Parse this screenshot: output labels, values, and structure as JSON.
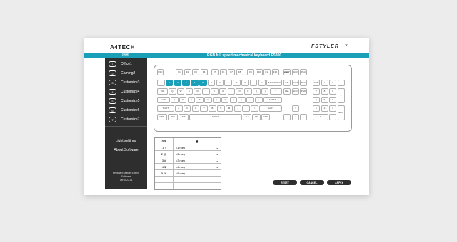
{
  "header": {
    "logo": "A4TECH",
    "logo_sub": "",
    "brand": "FSTYLER",
    "brand_sub": "",
    "close": "×",
    "keyboard_icon": "⌨",
    "title": "RGB full speed mechanical keyboard FS300"
  },
  "sidebar": {
    "profiles": [
      {
        "num": "1",
        "label": "Office1"
      },
      {
        "num": "2",
        "label": "Gaming2"
      },
      {
        "num": "3",
        "label": "Customize3"
      },
      {
        "num": "4",
        "label": "Customize4"
      },
      {
        "num": "5",
        "label": "Customize5"
      },
      {
        "num": "6",
        "label": "Customize6"
      },
      {
        "num": "7",
        "label": "Customize7"
      }
    ],
    "light_settings": "Light settings",
    "about": "About Software",
    "version_line1": "Keyboard Master Editing",
    "version_line2": "Software",
    "version_line3": "Ver.2022.11"
  },
  "keyboard": {
    "row0": [
      "ESC",
      "F1",
      "F2",
      "F3",
      "F4",
      "F5",
      "F6",
      "F7",
      "F8",
      "F9",
      "F10",
      "F11",
      "F12",
      "PRT",
      "SCR",
      "PAU"
    ],
    "row1": [
      "~",
      "1",
      "2",
      "3",
      "4",
      "5",
      "6",
      "7",
      "8",
      "9",
      "0",
      "-",
      "=",
      "BACKSPACE",
      "INS",
      "HOM",
      "PGU"
    ],
    "row2": [
      "TAB",
      "Q",
      "W",
      "E",
      "R",
      "T",
      "Y",
      "U",
      "I",
      "O",
      "P",
      "[",
      "]",
      "\\",
      "DEL",
      "END",
      "PGD"
    ],
    "row3": [
      "CAPS",
      "A",
      "S",
      "D",
      "F",
      "G",
      "H",
      "J",
      "K",
      "L",
      ";",
      "'",
      "ENTER"
    ],
    "row4": [
      "SHIFT",
      "Z",
      "X",
      "C",
      "V",
      "B",
      "N",
      "M",
      ",",
      ".",
      "/",
      "SHIFT",
      "↑"
    ],
    "row5": [
      "CTRL",
      "WIN",
      "ALT",
      "SPACE",
      "ALT",
      "FN",
      "CTRL",
      "←",
      "↓",
      "→"
    ],
    "numpad": {
      "r1": [
        "NUM",
        "/",
        "*",
        "-"
      ],
      "r2": [
        "7",
        "8",
        "9"
      ],
      "r3": [
        "4",
        "5",
        "6"
      ],
      "r4": [
        "1",
        "2",
        "3"
      ],
      "r5": [
        "0",
        "."
      ],
      "plus": "+",
      "enter": "ENT"
    }
  },
  "mapping_table": {
    "header_key_icon": "⌨",
    "header_mouse_icon": "🖱",
    "rows": [
      {
        "key": "1 !",
        "value": "<1>key"
      },
      {
        "key": "2 @",
        "value": "<2>key"
      },
      {
        "key": "3 #",
        "value": "<3>key"
      },
      {
        "key": "4 $",
        "value": "<4>key"
      },
      {
        "key": "5 %",
        "value": "<5>key"
      }
    ],
    "chevron": "⌄"
  },
  "buttons": {
    "reset": "RESET",
    "cancel": "CANCEL",
    "apply": "APPLY"
  },
  "colors": {
    "accent": "#1a9fb8",
    "sidebar": "#2e2e2e"
  }
}
